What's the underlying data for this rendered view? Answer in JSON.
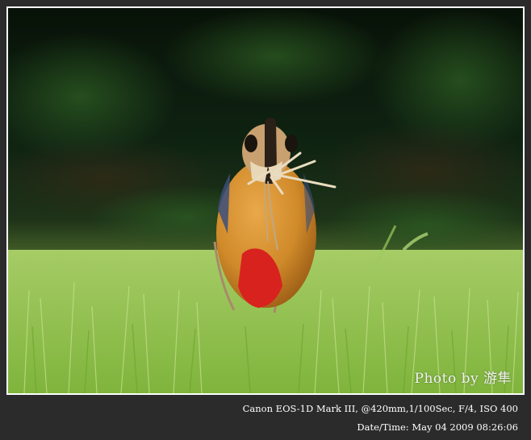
{
  "photo": {
    "subject": "bird-with-nesting-material-on-grass",
    "watermark": "Photo by 游隼"
  },
  "exif": {
    "camera_line": "Canon EOS-1D Mark III,  @420mm,1/100Sec, F/4, ISO 400",
    "date_line": "Date/Time: May 04 2009 08:26:06"
  },
  "colors": {
    "frame": "#2b2b2b",
    "border": "#ffffff",
    "grass": "#8fbf4a",
    "background_foliage": "#0f2410",
    "bird_body": "#d08a2a",
    "bird_vent": "#d8221e"
  }
}
